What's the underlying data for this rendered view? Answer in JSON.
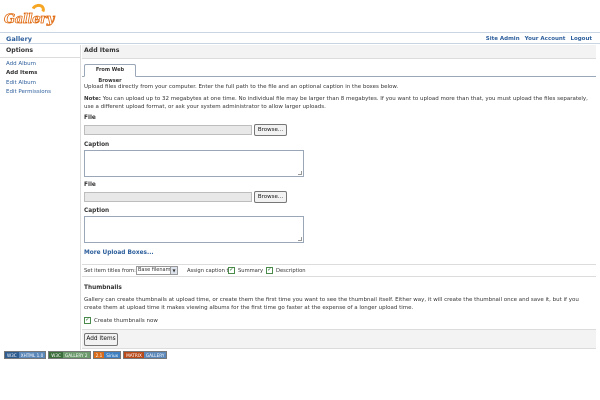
{
  "logo": {
    "text": "Gallery"
  },
  "topbar": {
    "gallery_link": "Gallery",
    "links": [
      "Site Admin",
      "Your Account",
      "Logout"
    ]
  },
  "sidebar": {
    "title": "Options",
    "items": [
      {
        "label": "Add Album",
        "current": false
      },
      {
        "label": "Add Items",
        "current": true
      },
      {
        "label": "Edit Album",
        "current": false
      },
      {
        "label": "Edit Permissions",
        "current": false
      }
    ]
  },
  "main": {
    "header": "Add Items",
    "tab_label": "From Web Browser",
    "intro": "Upload files directly from your computer. Enter the full path to the file and an optional caption in the boxes below.",
    "note_label": "Note:",
    "note": "You can upload up to 32 megabytes at one time. No individual file may be larger than 8 megabytes. If you want to upload more than that, you must upload the files separately, use a different upload format, or ask your system administrator to allow larger uploads.",
    "file_label": "File",
    "browse_label": "Browse...",
    "caption_label": "Caption",
    "more_link": "More Upload Boxes...",
    "set_titles_label": "Set item titles from:",
    "set_titles_value": "Base filename",
    "assign_caption_label": "Assign caption to:",
    "summary_label": "Summary",
    "description_label": "Description",
    "thumbnails_title": "Thumbnails",
    "thumbnails_text": "Gallery can create thumbnails at upload time, or create them the first time you want to see the thumbnail itself. Either way, it will create the thumbnail once and save it, but if you create them at upload time it makes viewing albums for the first time go faster at the expense of a longer upload time.",
    "create_thumbs_label": "Create thumbnails now",
    "submit_label": "Add Items"
  },
  "badges": [
    {
      "left": "W3C",
      "right": "XHTML 1.0",
      "colors": [
        "#2f5c8f",
        "#5a86b8"
      ]
    },
    {
      "left": "W3C",
      "right": "GALLERY 2",
      "colors": [
        "#3c6e3c",
        "#6c9a6c"
      ]
    },
    {
      "left": "2.1",
      "right": "Siriux",
      "colors": [
        "#d86b1a",
        "#3d7fc0"
      ]
    },
    {
      "left": "MATRIX",
      "right": "GALLERY",
      "colors": [
        "#b84a1a",
        "#5a86b8"
      ]
    }
  ]
}
